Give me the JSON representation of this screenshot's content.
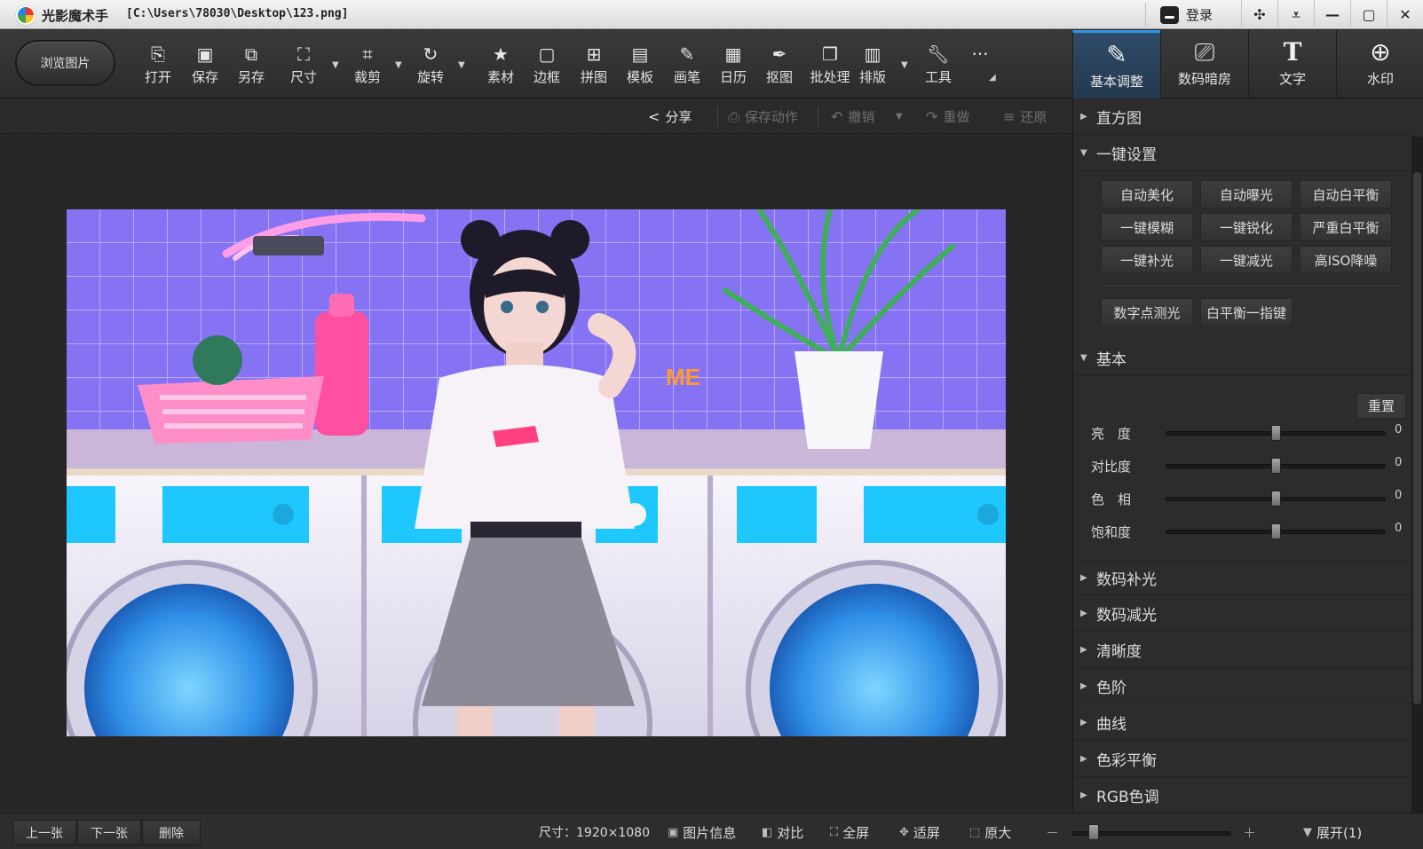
{
  "titlebar": {
    "app_name": "光影魔术手",
    "file_path": "[C:\\Users\\78030\\Desktop\\123.png]",
    "login_label": "登录",
    "buttons": [
      "skin-icon",
      "menu-icon",
      "minimize-icon",
      "maximize-icon",
      "close-icon"
    ]
  },
  "toolbar": {
    "browse_label": "浏览图片",
    "tools": [
      {
        "label": "打开",
        "icon": "open-icon"
      },
      {
        "label": "保存",
        "icon": "save-icon"
      },
      {
        "label": "另存",
        "icon": "save-as-icon"
      },
      {
        "label": "尺寸",
        "icon": "resize-icon"
      },
      {
        "label": "裁剪",
        "icon": "crop-icon"
      },
      {
        "label": "旋转",
        "icon": "rotate-icon"
      },
      {
        "label": "素材",
        "icon": "material-icon"
      },
      {
        "label": "边框",
        "icon": "border-icon"
      },
      {
        "label": "拼图",
        "icon": "collage-icon"
      },
      {
        "label": "模板",
        "icon": "template-icon"
      },
      {
        "label": "画笔",
        "icon": "brush-icon"
      },
      {
        "label": "日历",
        "icon": "calendar-icon"
      },
      {
        "label": "抠图",
        "icon": "cutout-icon"
      },
      {
        "label": "批处理",
        "icon": "batch-icon"
      },
      {
        "label": "排版",
        "icon": "layout-icon"
      },
      {
        "label": "工具",
        "icon": "wrench-icon"
      }
    ],
    "more_label": "···"
  },
  "right_tabs": [
    {
      "label": "基本调整",
      "icon": "edit-icon",
      "active": true
    },
    {
      "label": "数码暗房",
      "icon": "camera-icon",
      "active": false
    },
    {
      "label": "文字",
      "icon": "text-icon",
      "active": false
    },
    {
      "label": "水印",
      "icon": "watermark-icon",
      "active": false
    }
  ],
  "actionbar": {
    "share": "分享",
    "save_action": "保存动作",
    "undo": "撤销",
    "redo": "重做",
    "restore": "还原"
  },
  "panel": {
    "histogram": "直方图",
    "one_click": "一键设置",
    "one_click_buttons": [
      "自动美化",
      "自动曝光",
      "自动白平衡",
      "一键模糊",
      "一键锐化",
      "严重白平衡",
      "一键补光",
      "一键减光",
      "高ISO降噪"
    ],
    "extra_buttons": [
      "数字点测光",
      "白平衡一指键"
    ],
    "basic": "基本",
    "reset": "重置",
    "sliders": [
      {
        "label": "亮　度",
        "value": "0",
        "level": 0.5
      },
      {
        "label": "对比度",
        "value": "0",
        "level": 0.5
      },
      {
        "label": "色　相",
        "value": "0",
        "level": 0.5
      },
      {
        "label": "饱和度",
        "value": "0",
        "level": 0.5
      }
    ],
    "sections": [
      "数码补光",
      "数码减光",
      "清晰度",
      "色阶",
      "曲线",
      "色彩平衡",
      "RGB色调"
    ]
  },
  "statusbar": {
    "prev": "上一张",
    "next": "下一张",
    "delete": "删除",
    "size": "尺寸：1920×1080",
    "info": "图片信息",
    "compare": "对比",
    "fullscreen": "全屏",
    "fit": "适屏",
    "original": "原大",
    "zoom_minus": "－",
    "zoom_plus": "＋",
    "zoom_level": 0.14,
    "expand": "展开(1)"
  },
  "photo": {
    "neon_text": "ME"
  }
}
